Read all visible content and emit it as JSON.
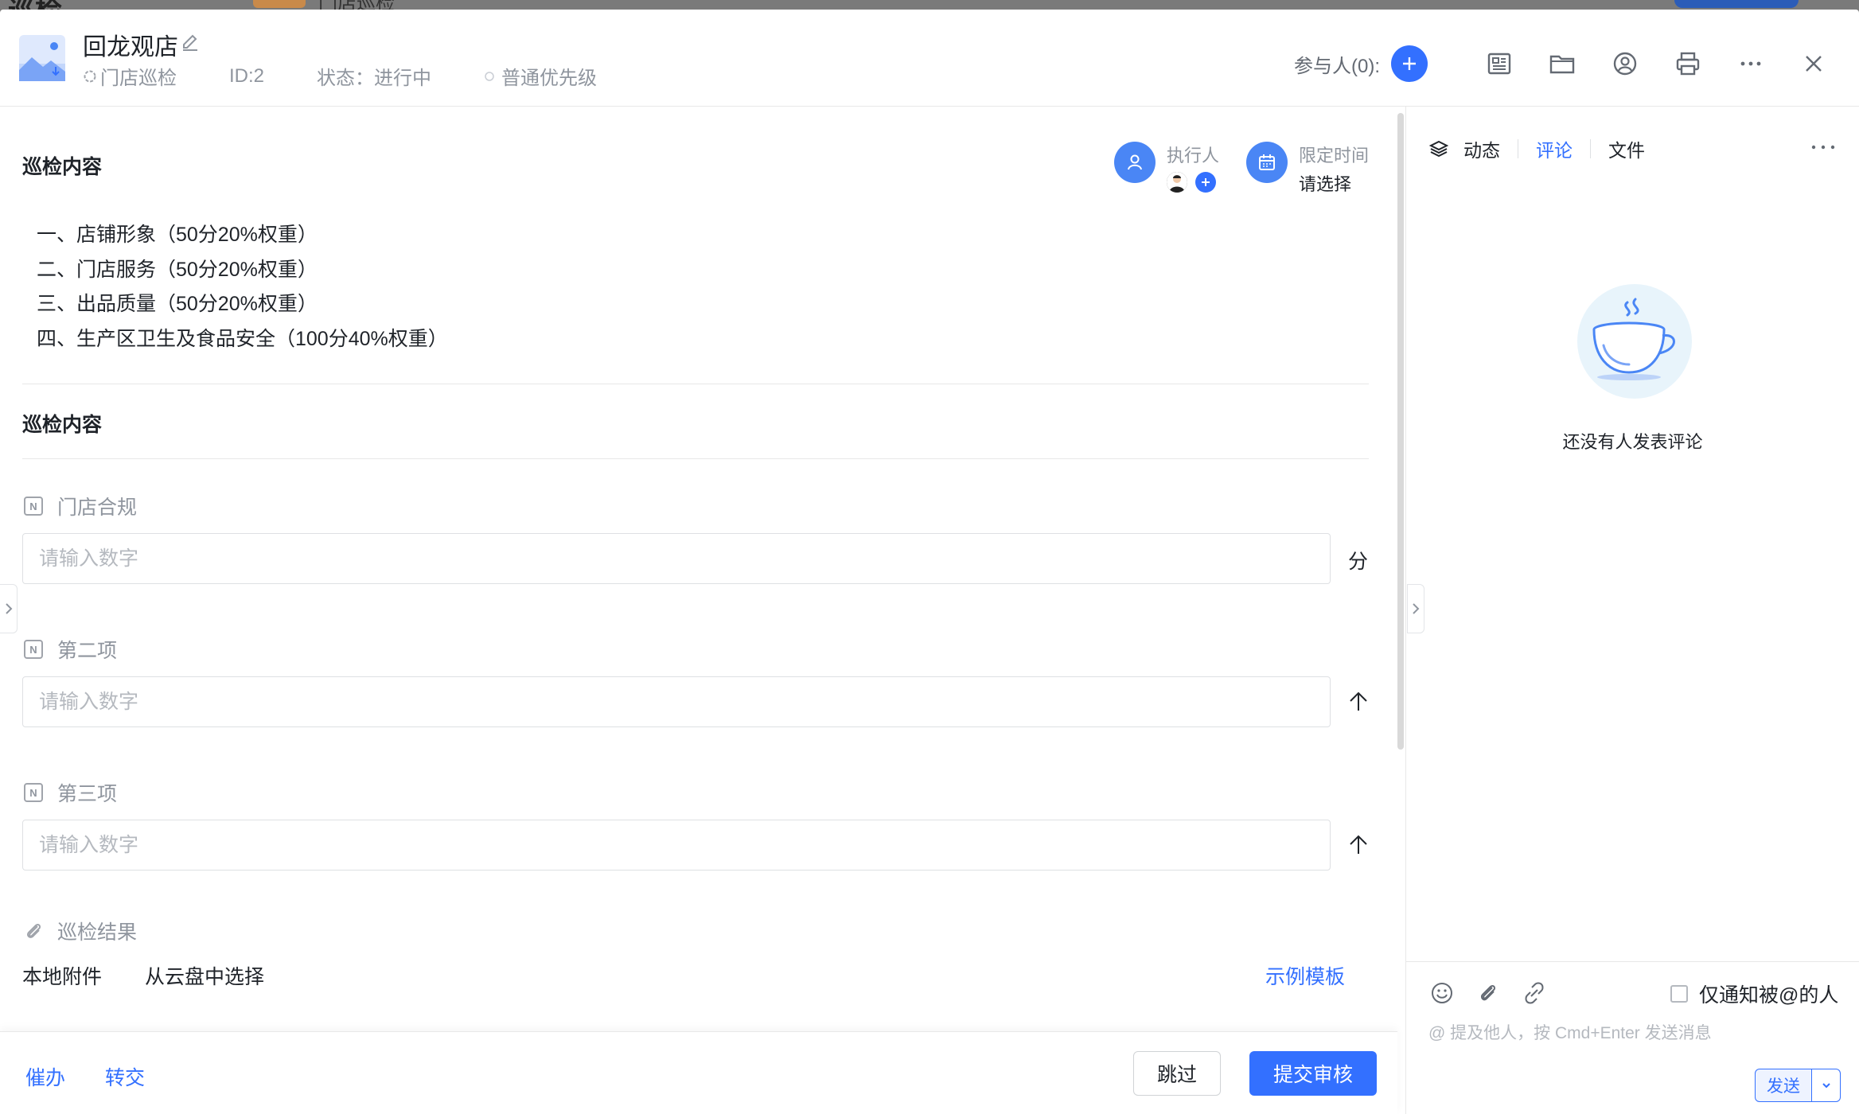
{
  "colors": {
    "accent": "#3370ff",
    "text_primary": "#1f2329",
    "text_secondary": "#8f959e",
    "border": "#dee0e3"
  },
  "backdrop": {
    "title": "巡检",
    "tab": "门店巡检"
  },
  "header": {
    "title": "回龙观店",
    "meta": {
      "category": "门店巡检",
      "id": "ID:2",
      "status": "状态：进行中",
      "priority": "普通优先级"
    },
    "participants_label": "参与人(0):",
    "icons": [
      "add-icon",
      "document-icon",
      "folder-icon",
      "user-circle-icon",
      "print-icon",
      "more-icon",
      "close-icon"
    ]
  },
  "content": {
    "section1_title": "巡检内容",
    "assignee": {
      "label": "执行人"
    },
    "deadline": {
      "label": "限定时间",
      "value": "请选择"
    },
    "outline": [
      "一、店铺形象（50分20%权重）",
      "二、门店服务（50分20%权重）",
      "三、出品质量（50分20%权重）",
      "四、生产区卫生及食品安全（100分40%权重）"
    ],
    "section2_title": "巡检内容",
    "fields": [
      {
        "label": "门店合规",
        "placeholder": "请输入数字",
        "unit": "分",
        "value": ""
      },
      {
        "label": "第二项",
        "placeholder": "请输入数字",
        "unit": "",
        "value": ""
      },
      {
        "label": "第三项",
        "placeholder": "请输入数字",
        "unit": "",
        "value": ""
      }
    ],
    "attachment": {
      "label": "巡检结果",
      "local": "本地附件",
      "cloud": "从云盘中选择",
      "template": "示例模板"
    }
  },
  "footer": {
    "urge": "催办",
    "transfer": "转交",
    "skip": "跳过",
    "submit": "提交审核"
  },
  "sidebar": {
    "tabs": [
      {
        "label": "动态",
        "active": false
      },
      {
        "label": "评论",
        "active": true
      },
      {
        "label": "文件",
        "active": false
      }
    ],
    "empty_text": "还没有人发表评论",
    "notify_only": "仅通知被@的人",
    "comment_placeholder": "@ 提及他人，按 Cmd+Enter 发送消息",
    "send": "发送"
  }
}
